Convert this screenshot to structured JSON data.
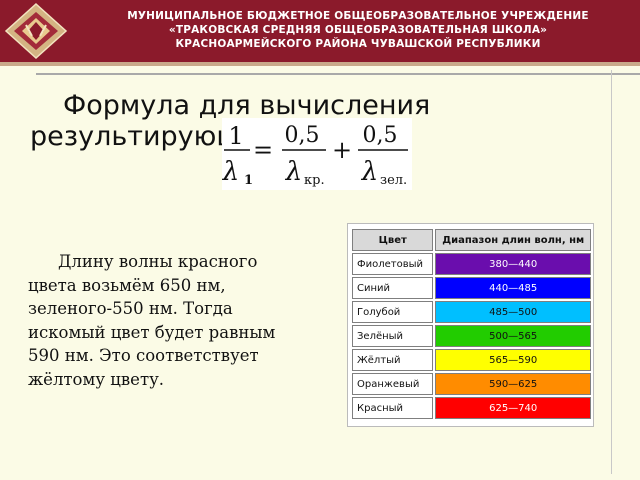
{
  "header": {
    "line1": "МУНИЦИПАЛЬНОЕ БЮДЖЕТНОЕ ОБЩЕОБРАЗОВАТЕЛЬНОЕ УЧРЕЖДЕНИЕ",
    "line2": "«ТРАКОВСКАЯ СРЕДНЯЯ ОБЩЕОБРАЗОВАТЕЛЬНАЯ ШКОЛА»",
    "line3": "КРАСНОАРМЕЙСКОГО РАЙОНА ЧУВАШСКОЙ РЕСПУБЛИКИ",
    "logo_icon": "school-emblem-icon"
  },
  "title": {
    "line1": "Формула для вычисления",
    "line2": "результирующего цвета:"
  },
  "formula": {
    "lhs_num": "1",
    "lhs_den": "λ",
    "lhs_sub": "1",
    "eq": "=",
    "t1_num": "0,5",
    "t1_den": "λ",
    "t1_sub": "кр.",
    "plus": "+",
    "t2_num": "0,5",
    "t2_den": "λ",
    "t2_sub": "зел."
  },
  "body_text": {
    "line1": "Длину волны красного",
    "line2": "цвета возьмём 650 нм,",
    "line3": "зеленого-550 нм. Тогда",
    "line4": "искомый цвет будет равным",
    "line5": "590 нм. Это соответствует",
    "line6": "жёлтому цвету."
  },
  "color_table": {
    "headers": [
      "Цвет",
      "Диапазон длин волн, нм"
    ],
    "rows": [
      {
        "name": "Фиолетовый",
        "range": "380—440",
        "color": "#6a0dad",
        "text_color": "#ffffff"
      },
      {
        "name": "Синий",
        "range": "440—485",
        "color": "#0000ff",
        "text_color": "#ffffff"
      },
      {
        "name": "Голубой",
        "range": "485—500",
        "color": "#00bfff",
        "text_color": "#111111"
      },
      {
        "name": "Зелёный",
        "range": "500—565",
        "color": "#22cc00",
        "text_color": "#111111"
      },
      {
        "name": "Жёлтый",
        "range": "565—590",
        "color": "#ffff00",
        "text_color": "#111111"
      },
      {
        "name": "Оранжевый",
        "range": "590—625",
        "color": "#ff8c00",
        "text_color": "#111111"
      },
      {
        "name": "Красный",
        "range": "625—740",
        "color": "#ff0000",
        "text_color": "#ffffff"
      }
    ]
  },
  "colors": {
    "header_bg": "#8b1a2b",
    "page_bg": "#fbfbe6"
  }
}
